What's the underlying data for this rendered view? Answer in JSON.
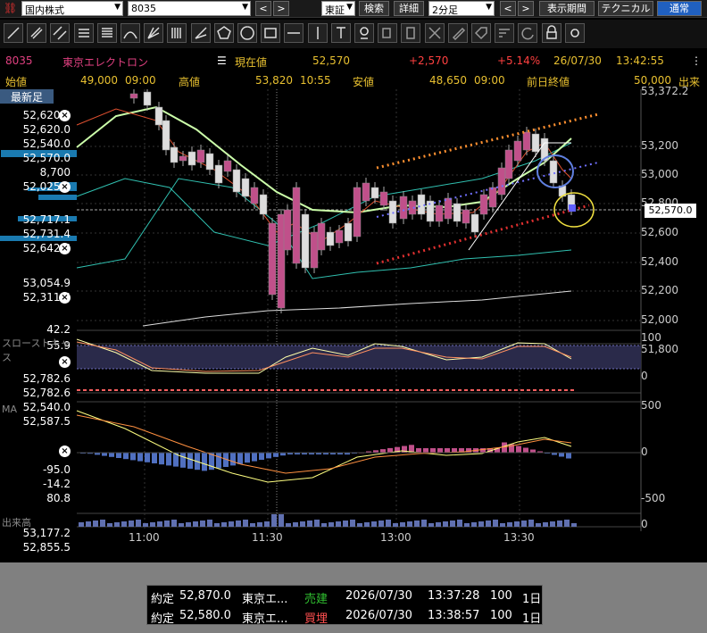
{
  "toolbar": {
    "market_select": "国内株式",
    "code_input": "8035",
    "exchange_select": "東証",
    "search_button": "検索",
    "detail_button": "詳細",
    "interval_select": "2分足",
    "period_button": "表示期間",
    "technical_button": "テクニカル",
    "normal_button": "通常",
    "prev_arrow": "<",
    "next_arrow": ">"
  },
  "quote": {
    "code": "8035",
    "name": "東京エレクトロン",
    "price_label": "現在値",
    "price": "52,570",
    "change": "+2,570",
    "change_pct": "+5.14%",
    "date": "26/07/30",
    "time": "13:42:55",
    "volume_label": "出来",
    "open_label": "始値",
    "open": "49,000",
    "open_time": "09:00",
    "high_label": "高値",
    "high": "53,820",
    "high_time": "10:55",
    "low_label": "安値",
    "low": "48,650",
    "low_time": "09:00",
    "prev_close_label": "前日終値",
    "prev_close": "50,000"
  },
  "left_panel": {
    "header_text": "最新足",
    "values": [
      "52,620.0",
      "52,620.0",
      "52,540.0",
      "52,570.0",
      "8,700",
      "52,025.8",
      "52,717.1",
      "52,731.4",
      "52,642.6",
      "53,054.9",
      "52,311.5",
      "42.2",
      "55.9",
      "52,782.6",
      "52,782.6",
      "52,540.0",
      "52,587.5",
      "-95.0",
      "-14.2",
      "80.8",
      "53,177.2",
      "52,855.5"
    ],
    "stoch_label": "スローストキャス",
    "ma_label": "MA",
    "volume_label": "出来高"
  },
  "price_axis": [
    "53,372.2",
    "53,200",
    "53,000",
    "52,800",
    "52,600",
    "52,400",
    "52,200",
    "52,000",
    "51,800"
  ],
  "current_price_tag": "52,570.0",
  "stoch_axis": [
    "100",
    "0"
  ],
  "macd_axis": [
    "500",
    "0",
    "-500"
  ],
  "volume_axis": [
    "0"
  ],
  "time_axis": [
    "11:00",
    "11:30",
    "13:00",
    "13:30"
  ],
  "colors": {
    "up": "#c0508a",
    "down": "#dddddd",
    "ma_short": "#e05030",
    "ma_mid": "#ccffaa",
    "ma_long": "#dddddd",
    "bollinger": "#30c0b0",
    "trend_upper": "#ff9030",
    "trend_lower": "#e03030",
    "trend_mid": "#7070ff"
  },
  "orders": [
    {
      "type": "約定",
      "price": "52,870.0",
      "name": "東京エ...",
      "side": "売建",
      "date": "2026/07/30",
      "time": "13:37:28",
      "qty": "100",
      "days": "1日"
    },
    {
      "type": "約定",
      "price": "52,580.0",
      "name": "東京エ...",
      "side": "買埋",
      "date": "2026/07/30",
      "time": "13:38:57",
      "qty": "100",
      "days": "1日"
    }
  ]
}
